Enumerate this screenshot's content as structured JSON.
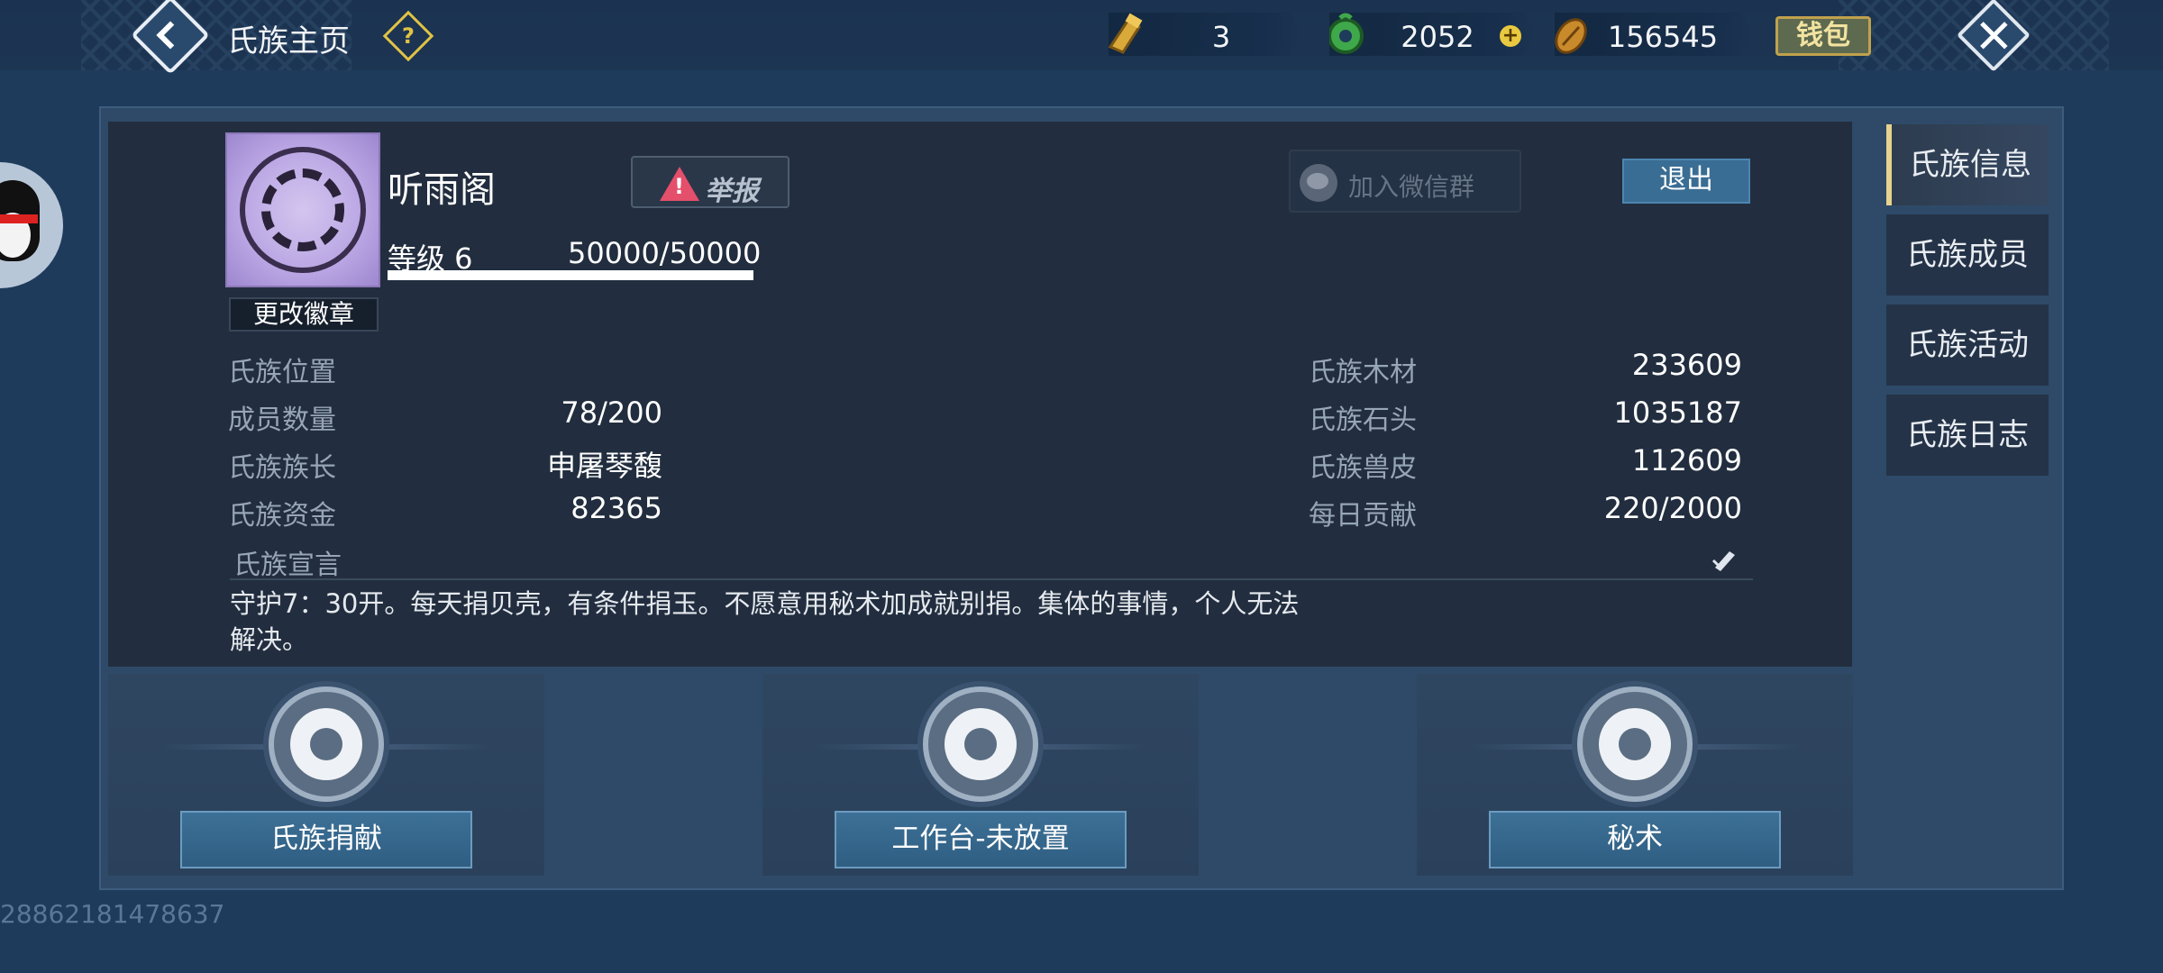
{
  "header": {
    "title": "氏族主页",
    "currencies": [
      {
        "icon": "golden-token-icon",
        "value": "3"
      },
      {
        "icon": "jade-icon",
        "value": "2052"
      },
      {
        "icon": "shell-icon",
        "value": "156545"
      }
    ],
    "wallet_label": "钱包"
  },
  "clan": {
    "name": "听雨阁",
    "report_label": "举报",
    "level_label": "等级 6",
    "exp": "50000/50000",
    "exp_fraction": 1.0,
    "change_badge_label": "更改徽章",
    "wechat_label": "加入微信群",
    "quit_label": "退出"
  },
  "stats_left": [
    {
      "label": "氏族位置",
      "value": ""
    },
    {
      "label": "成员数量",
      "value": "78/200"
    },
    {
      "label": "氏族族长",
      "value": "申屠琴馥"
    },
    {
      "label": "氏族资金",
      "value": "82365"
    }
  ],
  "stats_right": [
    {
      "label": "氏族木材",
      "value": "233609"
    },
    {
      "label": "氏族石头",
      "value": "1035187"
    },
    {
      "label": "氏族兽皮",
      "value": "112609"
    },
    {
      "label": "每日贡献",
      "value": "220/2000"
    }
  ],
  "manifesto": {
    "label": "氏族宣言",
    "text": "守护7：30开。每天捐贝壳，有条件捐玉。不愿意用秘术加成就别捐。集体的事情，个人无法解决。"
  },
  "actions": [
    {
      "label": "氏族捐献"
    },
    {
      "label": "工作台-未放置"
    },
    {
      "label": "秘术"
    }
  ],
  "tabs": [
    {
      "label": "氏族信息",
      "active": true
    },
    {
      "label": "氏族成员",
      "active": false
    },
    {
      "label": "氏族活动",
      "active": false
    },
    {
      "label": "氏族日志",
      "active": false
    }
  ],
  "uid": "28862181478637",
  "colors": {
    "background": "#1f3b5c",
    "card": "#222e3f",
    "button_blue": "#3a6d93",
    "gold": "#e1c245",
    "report_red": "#e44f6b"
  }
}
